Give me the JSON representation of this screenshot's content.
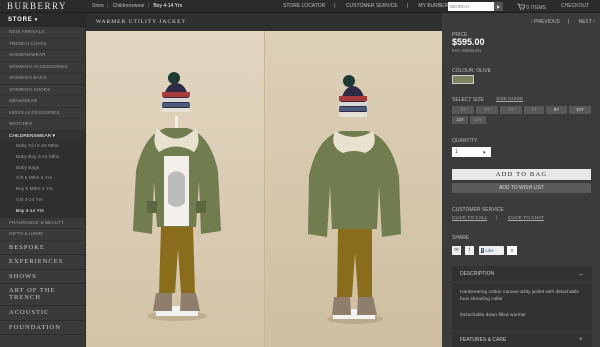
{
  "header": {
    "logo": "BURBERRY",
    "breadcrumbs": [
      "Store",
      "Childrenswear",
      "Boy 4-14 Yrs"
    ],
    "links": [
      "STORE LOCATOR",
      "CUSTOMER SERVICE",
      "MY BURBERRY"
    ],
    "search_placeholder": "SEARCH",
    "bag": "0 ITEMS",
    "checkout": "CHECKOUT"
  },
  "sidebar": {
    "store_label": "STORE",
    "items": [
      "New Arrivals",
      "Trench Coats",
      "Womenswear",
      "Women's Accessories",
      "Women's Bags",
      "Women's Shoes",
      "Menswear",
      "Men's Accessories",
      "Watches"
    ],
    "open_item": "Childrenswear",
    "sub_items": [
      "Baby Girl 0-24 Mths",
      "Baby Boy 0-24 Mths",
      "Baby Bags",
      "Girl 6 Mths-3 Yrs",
      "Boy 6 Mths-3 Yrs",
      "Girl 4-14 Yrs",
      "Boy 4-14 Yrs"
    ],
    "more_items": [
      "Fragrance & Beauty",
      "Gifts & Home"
    ],
    "big_items": [
      "BESPOKE",
      "EXPERIENCES",
      "SHOWS",
      "ART OF THE TRENCH",
      "ACOUSTIC",
      "FOUNDATION"
    ]
  },
  "product": {
    "title": "WARMER UTILITY JACKET",
    "prev": "‹ PREVIOUS",
    "next": "NEXT ›",
    "price_label": "PRICE",
    "price": "$595.00",
    "item_number": "Item 38586391",
    "colour_label": "COLOUR: OLIVE",
    "size_label": "SELECT SIZE",
    "size_guide": "SIZE GUIDE",
    "sizes": [
      "4Y",
      "5Y",
      "6Y",
      "7Y",
      "8Y",
      "10Y",
      "12Y",
      "14Y"
    ],
    "quantity_label": "QUANTITY",
    "quantity": "1",
    "add_to_bag": "ADD TO BAG",
    "wishlist": "ADD TO WISH LIST",
    "customer_service": "CUSTOMER SERVICE",
    "cs_links": [
      "CLICK TO CALL",
      "CLICK TO CHAT"
    ],
    "share_label": "SHARE",
    "fb_like": "Like",
    "fb_count": "0",
    "description_label": "DESCRIPTION",
    "description": [
      "Hardwearing cotton canvas utility jacket with detachable faux shearling collar",
      "Detachable down-filled warmer"
    ],
    "features_label": "FEATURES & CARE"
  },
  "colors": {
    "swatch_olive": "#7b8260",
    "jacket": "#717c4f",
    "trousers": "#8a6d1c"
  }
}
